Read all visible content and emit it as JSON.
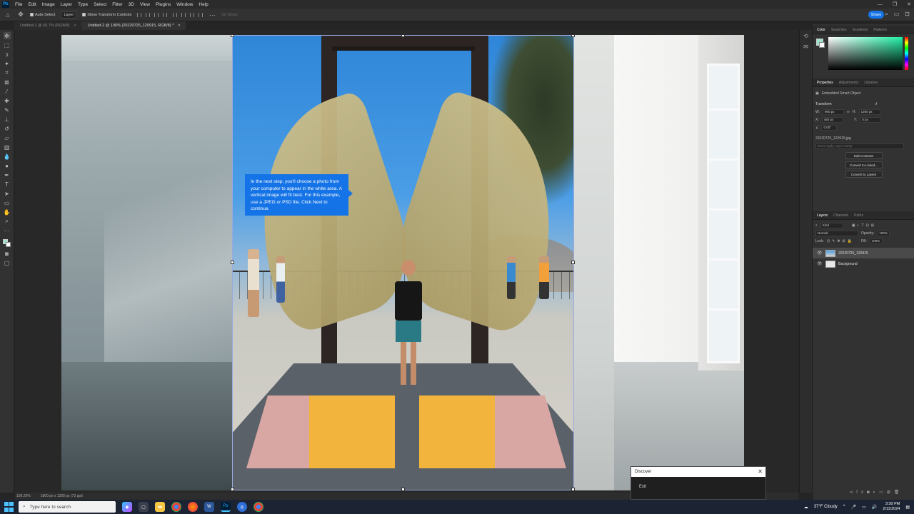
{
  "app": {
    "logo": "Ps"
  },
  "menubar": {
    "items": [
      "File",
      "Edit",
      "Image",
      "Layer",
      "Type",
      "Select",
      "Filter",
      "3D",
      "View",
      "Plugins",
      "Window",
      "Help"
    ],
    "window_controls": [
      "—",
      "❐",
      "✕"
    ]
  },
  "options_bar": {
    "auto_select_label": "Auto-Select",
    "layer_dropdown": "Layer",
    "show_transform_label": "Show Transform Controls",
    "mode_3d_label": "3D Mode:",
    "share_label": "Share",
    "more_label": "···"
  },
  "tabs": [
    {
      "label": "Untitled-1 @ 66.7% (RGB/8)",
      "close": "×"
    },
    {
      "label": "Untitled-2 @ 106% (20220725_120915, RGB/8) *",
      "close": "×"
    }
  ],
  "tooltip": {
    "text": "In the next step, you'll choose a photo from your computer to appear in the white area. A vertical image will fit best. For this example, use a JPEG or PSD file. Click Next to continue."
  },
  "color_panel": {
    "tabs": [
      "Color",
      "Swatches",
      "Gradients",
      "Patterns"
    ],
    "foreground": "#9fe3cf",
    "background": "#ffffff"
  },
  "properties_panel": {
    "tabs": [
      "Properties",
      "Adjustments",
      "Libraries"
    ],
    "object_type": "Embedded Smart Object",
    "transform_label": "Transform",
    "w_label": "W:",
    "w_value": "900 px",
    "h_label": "H:",
    "h_value": "1200 px",
    "x_label": "X:",
    "x_value": "450 px",
    "y_label": "Y:",
    "y_value": "0 px",
    "angle_value": "0.00°",
    "filename": "20220725_120915.jpg",
    "layer_comp_placeholder": "Don't Apply Layer Comp",
    "buttons": [
      "Edit Contents",
      "Convert to Linked...",
      "Convert to Layers"
    ]
  },
  "layers_panel": {
    "tabs": [
      "Layers",
      "Channels",
      "Paths"
    ],
    "kind_label": "Kind",
    "blend_mode": "Normal",
    "opacity_label": "Opacity:",
    "opacity_value": "100%",
    "lock_label": "Lock:",
    "fill_label": "Fill:",
    "fill_value": "100%",
    "layers": [
      {
        "name": "20220725_120915",
        "selected": true
      },
      {
        "name": "Background",
        "selected": false
      }
    ]
  },
  "status_bar": {
    "zoom": "106.29%",
    "doc_size": "1800 px x 1200 px (72 ppi)"
  },
  "discover": {
    "title": "Discover",
    "exit_label": "Exit",
    "close": "✕"
  },
  "taskbar": {
    "search_placeholder": "Type here to search",
    "weather": "37°F  Cloudy",
    "time": "3:30 PM",
    "date": "2/11/2024"
  }
}
